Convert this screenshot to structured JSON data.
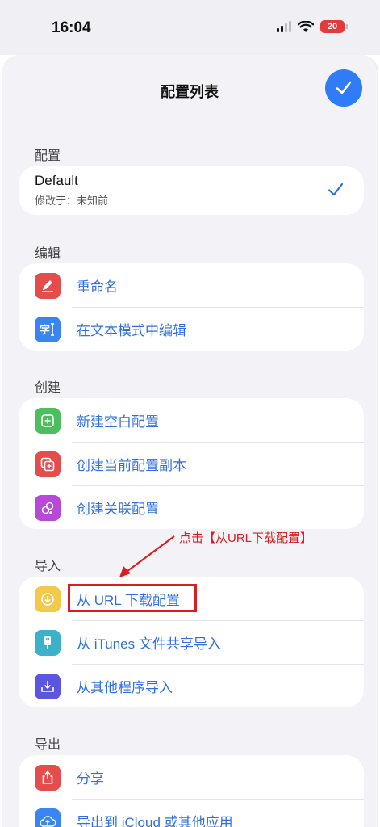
{
  "status_bar": {
    "time": "16:04",
    "battery": "20"
  },
  "header": {
    "title": "配置列表"
  },
  "sections": {
    "config": {
      "header": "配置",
      "item": {
        "name": "Default",
        "subtitle": "修改于：未知前"
      }
    },
    "edit": {
      "header": "编辑",
      "items": [
        {
          "label": "重命名",
          "icon": "rename-icon",
          "color": "#e54c4c"
        },
        {
          "label": "在文本模式中编辑",
          "icon": "text-edit-icon",
          "color": "#3a86f0"
        }
      ]
    },
    "create": {
      "header": "创建",
      "items": [
        {
          "label": "新建空白配置",
          "icon": "plus-icon",
          "color": "#4cbe5d"
        },
        {
          "label": "创建当前配置副本",
          "icon": "duplicate-icon",
          "color": "#e54c4c"
        },
        {
          "label": "创建关联配置",
          "icon": "link-icon",
          "color": "#b848d8"
        }
      ]
    },
    "import": {
      "header": "导入",
      "items": [
        {
          "label": "从 URL 下载配置",
          "icon": "download-icon",
          "color": "#f2c94a"
        },
        {
          "label": "从 iTunes 文件共享导入",
          "icon": "usb-icon",
          "color": "#3bb2c8"
        },
        {
          "label": "从其他程序导入",
          "icon": "import-icon",
          "color": "#5b56e0"
        }
      ]
    },
    "export": {
      "header": "导出",
      "items": [
        {
          "label": "分享",
          "icon": "share-icon",
          "color": "#e54c4c"
        },
        {
          "label": "导出到 iCloud 或其他应用",
          "icon": "cloud-upload-icon",
          "color": "#3a86f0"
        }
      ]
    }
  },
  "annotation": {
    "text": "点击【从URL下载配置】",
    "color": "#d81e1e"
  },
  "colors": {
    "accent": "#2f7cf6",
    "link": "#2f6fe0"
  }
}
